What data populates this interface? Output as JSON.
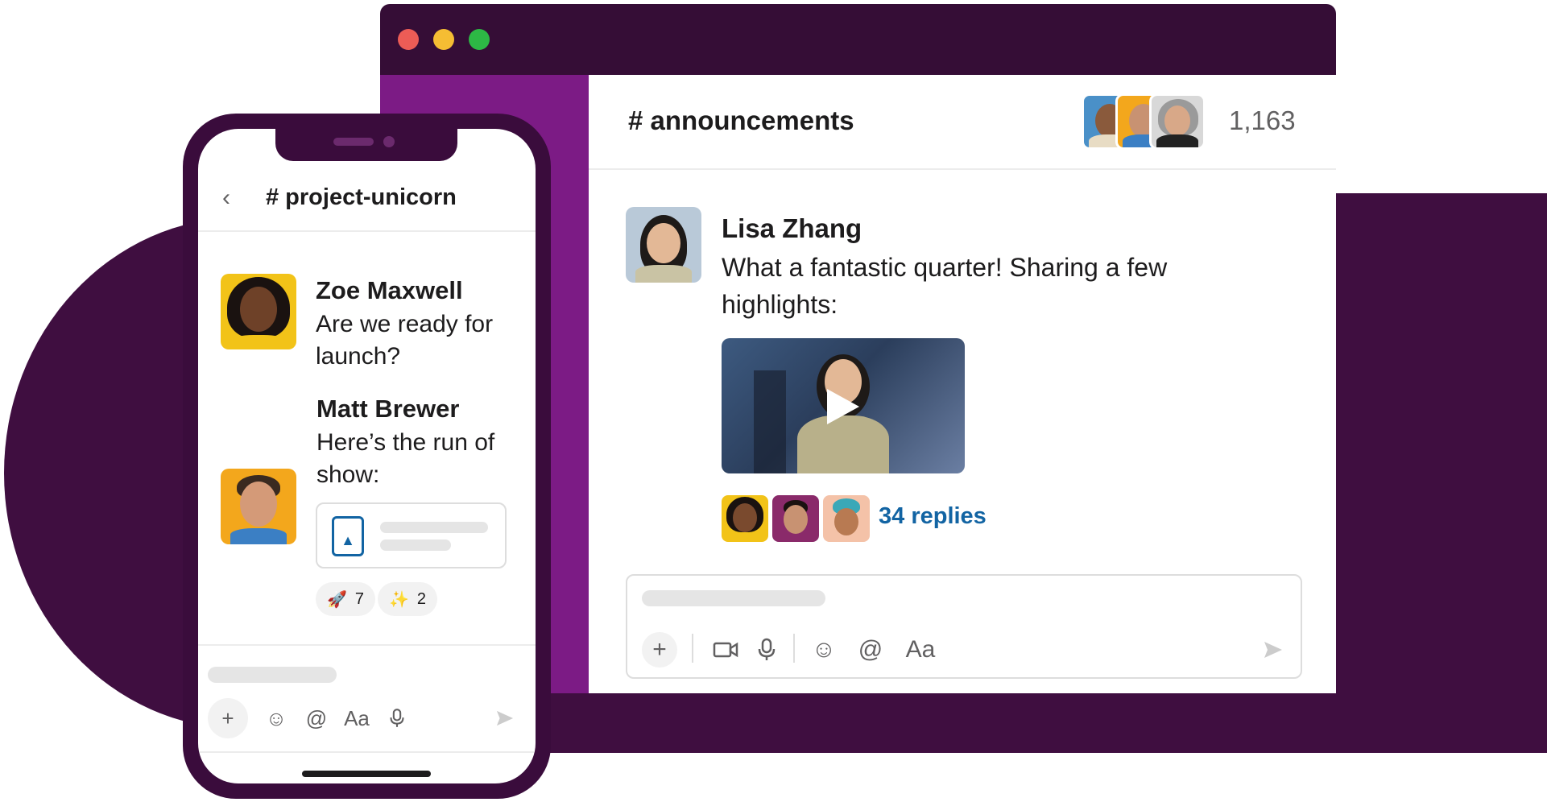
{
  "desktop": {
    "window_controls": [
      "close",
      "minimize",
      "maximize"
    ],
    "channel": {
      "name": "# announcements",
      "member_count": "1,163"
    },
    "message": {
      "author": "Lisa Zhang",
      "text": "What a fantastic quarter! Sharing a few highlights:",
      "attachment": "video",
      "replies": "34 replies"
    },
    "composer": {
      "icons": [
        "plus-icon",
        "video-icon",
        "microphone-icon",
        "emoji-icon",
        "mention-icon",
        "format-icon",
        "send-icon"
      ],
      "format_label": "Aa"
    }
  },
  "phone": {
    "channel": "# project-unicorn",
    "messages": [
      {
        "author": "Zoe Maxwell",
        "text": "Are we ready for launch?"
      },
      {
        "author": "Matt Brewer",
        "text": "Here’s the run of show:"
      }
    ],
    "reactions": [
      {
        "emoji": "🚀",
        "count": "7"
      },
      {
        "emoji": "✨",
        "count": "2"
      }
    ],
    "composer": {
      "format_label": "Aa"
    }
  },
  "colors": {
    "aubergine_dark": "#350d36",
    "aubergine_sidebar": "#7c1b85",
    "background_shape": "#3f0e40",
    "link_blue": "#1264a3",
    "close_dot": "#ec5c56",
    "minimize_dot": "#f5bd33",
    "maximize_dot": "#2db845"
  }
}
